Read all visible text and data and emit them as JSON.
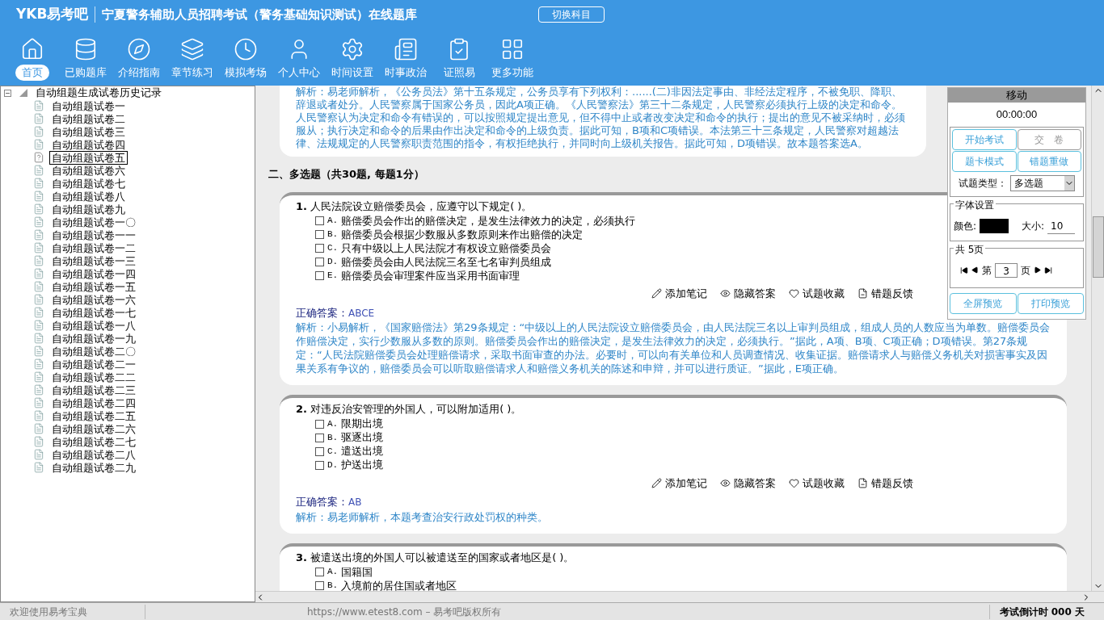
{
  "header": {
    "logo": "YKB易考吧",
    "title": "宁夏警务辅助人员招聘考试（警务基础知识测试）在线题库",
    "switch_button": "切换科目"
  },
  "toolbar": [
    {
      "label": "首页",
      "selected": true
    },
    {
      "label": "已购题库",
      "selected": false
    },
    {
      "label": "介绍指南",
      "selected": false
    },
    {
      "label": "章节练习",
      "selected": false
    },
    {
      "label": "模拟考场",
      "selected": false
    },
    {
      "label": "个人中心",
      "selected": false
    },
    {
      "label": "时间设置",
      "selected": false
    },
    {
      "label": "时事政治",
      "selected": false
    },
    {
      "label": "证照易",
      "selected": false
    },
    {
      "label": "更多功能",
      "selected": false
    }
  ],
  "tree": {
    "label": "自动组题生成试卷历史记录",
    "expanded": true,
    "children": [
      {
        "label": "自动组题试卷一",
        "selected": false
      },
      {
        "label": "自动组题试卷二",
        "selected": false
      },
      {
        "label": "自动组题试卷三",
        "selected": false
      },
      {
        "label": "自动组题试卷四",
        "selected": false
      },
      {
        "label": "自动组题试卷五",
        "selected": true
      },
      {
        "label": "自动组题试卷六",
        "selected": false
      },
      {
        "label": "自动组题试卷七",
        "selected": false
      },
      {
        "label": "自动组题试卷八",
        "selected": false
      },
      {
        "label": "自动组题试卷九",
        "selected": false
      },
      {
        "label": "自动组题试卷一〇",
        "selected": false
      },
      {
        "label": "自动组题试卷一一",
        "selected": false
      },
      {
        "label": "自动组题试卷一二",
        "selected": false
      },
      {
        "label": "自动组题试卷一三",
        "selected": false
      },
      {
        "label": "自动组题试卷一四",
        "selected": false
      },
      {
        "label": "自动组题试卷一五",
        "selected": false
      },
      {
        "label": "自动组题试卷一六",
        "selected": false
      },
      {
        "label": "自动组题试卷一七",
        "selected": false
      },
      {
        "label": "自动组题试卷一八",
        "selected": false
      },
      {
        "label": "自动组题试卷一九",
        "selected": false
      },
      {
        "label": "自动组题试卷二〇",
        "selected": false
      },
      {
        "label": "自动组题试卷二一",
        "selected": false
      },
      {
        "label": "自动组题试卷二二",
        "selected": false
      },
      {
        "label": "自动组题试卷二三",
        "selected": false
      },
      {
        "label": "自动组题试卷二四",
        "selected": false
      },
      {
        "label": "自动组题试卷二五",
        "selected": false
      },
      {
        "label": "自动组题试卷二六",
        "selected": false
      },
      {
        "label": "自动组题试卷二七",
        "selected": false
      },
      {
        "label": "自动组题试卷二八",
        "selected": false
      },
      {
        "label": "自动组题试卷二九",
        "selected": false
      }
    ]
  },
  "previous_analysis": "解析：易老师解析，《公务员法》第十五条规定，公务员享有下列权利：......(二)非因法定事由、非经法定程序，不被免职、降职、辞退或者处分。人民警察属于国家公务员，因此A项正确。《人民警察法》第三十二条规定，人民警察必须执行上级的决定和命令。人民警察认为决定和命令有错误的，可以按照规定提出意见，但不得中止或者改变决定和命令的执行；提出的意见不被采纳时，必须服从；执行决定和命令的后果由作出决定和命令的上级负责。据此可知，B项和C项错误。本法第三十三条规定，人民警察对超越法律、法规规定的人民警察职责范围的指令，有权拒绝执行，并同时向上级机关报告。据此可知，D项错误。故本题答案选A。",
  "section_heading": "二、多选题（共30题, 每题1分）",
  "questions": [
    {
      "number": "1.",
      "text": "人民法院设立赔偿委员会，应遵守以下规定( )。",
      "options": [
        {
          "label": "A.",
          "text": "赔偿委员会作出的赔偿决定，是发生法律效力的决定，必须执行",
          "checked": false
        },
        {
          "label": "B.",
          "text": "赔偿委员会根据少数服从多数原则来作出赔偿的决定",
          "checked": false
        },
        {
          "label": "C.",
          "text": "只有中级以上人民法院才有权设立赔偿委员会",
          "checked": false
        },
        {
          "label": "D.",
          "text": "赔偿委员会由人民法院三名至七名审判员组成",
          "checked": false
        },
        {
          "label": "E.",
          "text": "赔偿委员会审理案件应当采用书面审理",
          "checked": false
        }
      ],
      "actions": [
        "添加笔记",
        "隐藏答案",
        "试题收藏",
        "错题反馈"
      ],
      "answer_label": "正确答案：",
      "answer": "ABCE",
      "analysis": "解析：小易解析，《国家赔偿法》第29条规定：“中级以上的人民法院设立赔偿委员会，由人民法院三名以上审判员组成，组成人员的人数应当为单数。赔偿委员会作赔偿决定，实行少数服从多数的原则。赔偿委员会作出的赔偿决定，是发生法律效力的决定，必须执行。”据此，A项、B项、C项正确；D项错误。第27条规定：“人民法院赔偿委员会处理赔偿请求，采取书面审查的办法。必要时，可以向有关单位和人员调查情况、收集证据。赔偿请求人与赔偿义务机关对损害事实及因果关系有争议的，赔偿委员会可以听取赔偿请求人和赔偿义务机关的陈述和申辩，并可以进行质证。”据此，E项正确。"
    },
    {
      "number": "2.",
      "text": "对违反治安管理的外国人，可以附加适用( )。",
      "options": [
        {
          "label": "A.",
          "text": "限期出境",
          "checked": false
        },
        {
          "label": "B.",
          "text": "驱逐出境",
          "checked": false
        },
        {
          "label": "C.",
          "text": "遣送出境",
          "checked": false
        },
        {
          "label": "D.",
          "text": "护送出境",
          "checked": false
        }
      ],
      "actions": [
        "添加笔记",
        "隐藏答案",
        "试题收藏",
        "错题反馈"
      ],
      "answer_label": "正确答案：",
      "answer": "AB",
      "analysis": "解析：易老师解析，本题考查治安行政处罚权的种类。"
    },
    {
      "number": "3.",
      "text": "被遣送出境的外国人可以被遣送至的国家或者地区是( )。",
      "options": [
        {
          "label": "A.",
          "text": "国籍国",
          "checked": false
        },
        {
          "label": "B.",
          "text": "入境前的居住国或者地区",
          "checked": false
        }
      ]
    }
  ],
  "panel": {
    "title": "移动",
    "timer": "00:00:00",
    "buttons": [
      {
        "label": "开始考试",
        "disabled": false
      },
      {
        "label": "交　卷",
        "disabled": true
      },
      {
        "label": "题卡模式",
        "disabled": false
      },
      {
        "label": "错题重做",
        "disabled": false
      }
    ],
    "type_label": "试题类型：",
    "type_value": "多选题",
    "font_group": "字体设置",
    "color_label": "颜色:",
    "color": "#000000",
    "size_label": "大小:",
    "size_value": "10",
    "pager_group": "共 5页",
    "page_prefix": "第",
    "page_value": "3",
    "page_suffix": "页",
    "bottom_buttons": [
      "全屏预览",
      "打印预览"
    ]
  },
  "status_bar": {
    "welcome": "欢迎使用易考宝典",
    "copyright": "https://www.etest8.com – 易考吧版权所有",
    "countdown": "考试倒计时 000 天"
  }
}
